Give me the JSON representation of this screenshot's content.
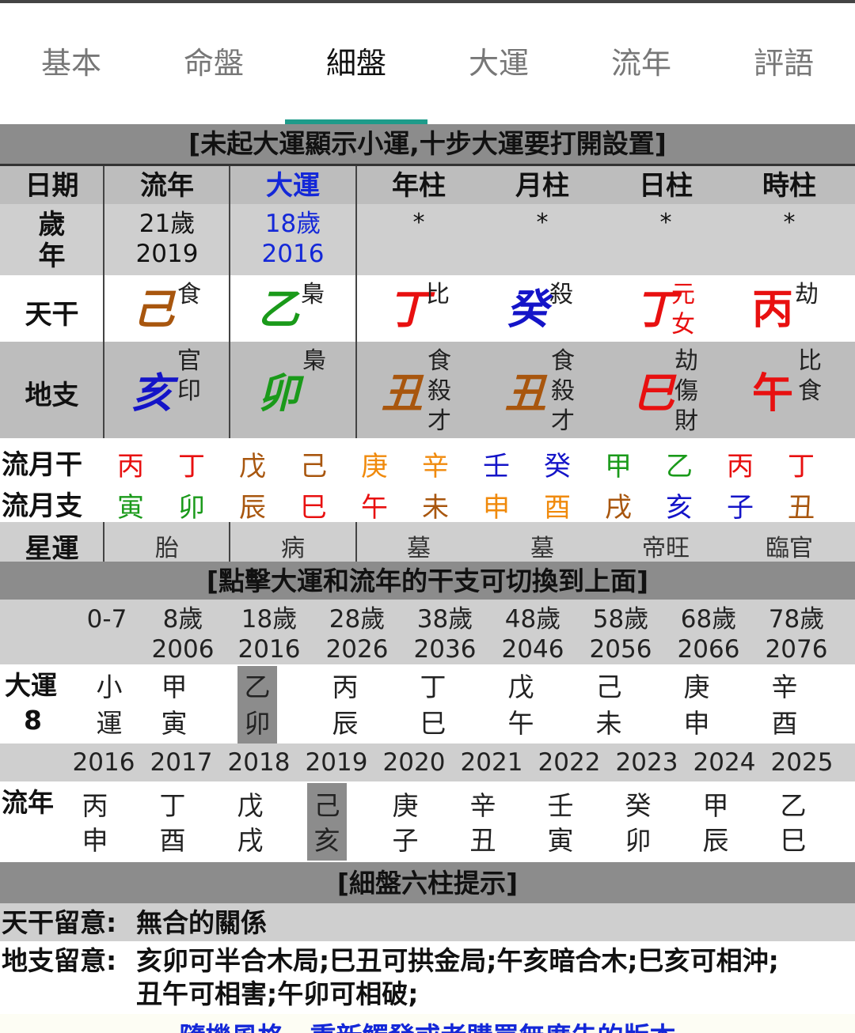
{
  "tabs": [
    "基本",
    "命盤",
    "細盤",
    "大運",
    "流年",
    "評語"
  ],
  "banner_top": "[未起大運顯示小運,十步大運要打開設置]",
  "header": {
    "date": "日期",
    "liunian": "流年",
    "dayun": "大運",
    "year": "年柱",
    "month": "月柱",
    "day": "日柱",
    "hour": "時柱"
  },
  "age_row": {
    "label_1": "歲",
    "label_2": "年",
    "liunian_age": "21歲",
    "liunian_year": "2019",
    "dayun_age": "18歲",
    "dayun_year": "2016",
    "star": "*"
  },
  "tiangan_row": {
    "label": "天干",
    "liunian": {
      "char": "己",
      "note": "食"
    },
    "dayun": {
      "char": "乙",
      "note": "梟"
    },
    "year": {
      "char": "丁",
      "note": "比"
    },
    "month": {
      "char": "癸",
      "note": "殺"
    },
    "day": {
      "char": "丁",
      "note_1": "元",
      "note_2": "女"
    },
    "hour": {
      "char": "丙",
      "note": "劫"
    }
  },
  "dizhi_row": {
    "label": "地支",
    "liunian": {
      "char": "亥",
      "note_1": "官",
      "note_2": "印"
    },
    "dayun": {
      "char": "卯",
      "note_1": "梟"
    },
    "year": {
      "char": "丑",
      "note_1": "食",
      "note_2": "殺",
      "note_3": "才"
    },
    "month": {
      "char": "丑",
      "note_1": "食",
      "note_2": "殺",
      "note_3": "才"
    },
    "day": {
      "char": "巳",
      "note_1": "劫",
      "note_2": "傷",
      "note_3": "財"
    },
    "hour": {
      "char": "午",
      "note_1": "比",
      "note_2": "食"
    }
  },
  "liuyue_gan": {
    "label": "流月干",
    "chars": [
      "丙",
      "丁",
      "戊",
      "己",
      "庚",
      "辛",
      "壬",
      "癸",
      "甲",
      "乙",
      "丙",
      "丁"
    ]
  },
  "liuyue_zhi": {
    "label": "流月支",
    "chars": [
      "寅",
      "卯",
      "辰",
      "巳",
      "午",
      "未",
      "申",
      "酉",
      "戌",
      "亥",
      "子",
      "丑"
    ]
  },
  "xingyun": {
    "label": "星運",
    "values": [
      "胎",
      "病",
      "墓",
      "墓",
      "帝旺",
      "臨官"
    ]
  },
  "banner_mid": "[點擊大運和流年的干支可切換到上面]",
  "dayun_list": {
    "label": "大運",
    "number": "8",
    "ages": [
      "0-7",
      "8歲",
      "18歲",
      "28歲",
      "38歲",
      "48歲",
      "58歲",
      "68歲",
      "78歲"
    ],
    "years": [
      "",
      "2006",
      "2016",
      "2026",
      "2036",
      "2046",
      "2056",
      "2066",
      "2076"
    ],
    "gan": [
      "小",
      "甲",
      "乙",
      "丙",
      "丁",
      "戊",
      "己",
      "庚",
      "辛"
    ],
    "zhi": [
      "運",
      "寅",
      "卯",
      "辰",
      "巳",
      "午",
      "未",
      "申",
      "酉"
    ]
  },
  "liunian_list": {
    "label": "流年",
    "years": [
      "2016",
      "2017",
      "2018",
      "2019",
      "2020",
      "2021",
      "2022",
      "2023",
      "2024",
      "2025"
    ],
    "gan": [
      "丙",
      "丁",
      "戊",
      "己",
      "庚",
      "辛",
      "壬",
      "癸",
      "甲",
      "乙"
    ],
    "zhi": [
      "申",
      "酉",
      "戌",
      "亥",
      "子",
      "丑",
      "寅",
      "卯",
      "辰",
      "巳"
    ]
  },
  "banner_hint": "[細盤六柱提示]",
  "hints": {
    "tiangan_label": "天干留意:",
    "tiangan_text": "無合的關係",
    "dizhi_label": "地支留意:",
    "dizhi_line1": "亥卯可半合木局;巳丑可拱金局;午亥暗合木;巳亥可相沖;",
    "dizhi_line2": "丑午可相害;午卯可相破;"
  },
  "bottom_link": "隨機風格，重新觸發或者購買無廣告的版本",
  "colors": {
    "earth": "#a8560e",
    "wood": "#1a9a1a",
    "fire": "#e81010",
    "water": "#1414c8",
    "metal": "#f08a0c",
    "blue_text": "#1428d8",
    "bar": "#8c8c8c",
    "light": "#cfcfcf",
    "mid": "#bdbdbd"
  }
}
